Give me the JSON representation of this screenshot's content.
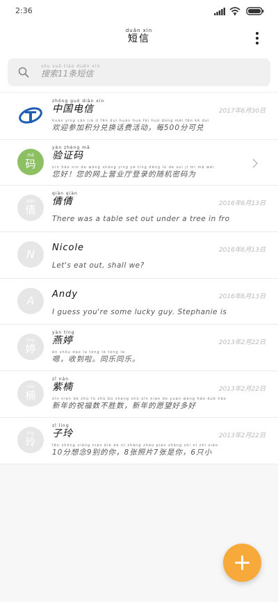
{
  "status_bar": {
    "time": "2:36"
  },
  "header": {
    "title_pinyin": "duǎn xìn",
    "title": "短信"
  },
  "search": {
    "placeholder_pinyin": "sōu suǒ  tiáo duǎn xìn",
    "placeholder": "搜索11条短信"
  },
  "conversations": [
    {
      "avatar_type": "telecom-logo",
      "name_pinyin": "zhōng guó diàn xìn",
      "name": "中国电信",
      "date": "2017年6月30日",
      "preview_pinyin": "huān yíng cān jiā jī fēn duì huàn huà fèi huó dòng  měi  fēn kě duì",
      "preview": "欢迎参加积分兑换话费活动，每500分可兑"
    },
    {
      "avatar_type": "green",
      "avatar_pinyin": "mǎ",
      "avatar_char": "码",
      "name_pinyin": "yàn zhèng mǎ",
      "name": "验证码",
      "date": "",
      "preview_pinyin": "nín hǎo  nín de wǎng shàng yíng yè tīng dēng lù de suí jī mì mǎ wéi",
      "preview": "您好！您的网上营业厅登录的随机密码为",
      "has_chevron": true
    },
    {
      "avatar_type": "gray",
      "avatar_pinyin": "qiàn",
      "avatar_char": "倩",
      "name_pinyin": "qiàn qiàn",
      "name": "倩倩",
      "date": "2016年6月13日",
      "preview": "There was a table set out under a tree in front o"
    },
    {
      "avatar_type": "gray-letter",
      "avatar_letter": "N",
      "name": "Nicole",
      "date": "2016年6月13日",
      "preview": "Let's eat out, shall we?"
    },
    {
      "avatar_type": "gray-letter",
      "avatar_letter": "A",
      "name": "Andy",
      "date": "2016年6月13日",
      "preview": "I guess you're some lucky guy. Stephanie is a nice"
    },
    {
      "avatar_type": "gray",
      "avatar_pinyin": "tíng",
      "avatar_char": "婷",
      "name_pinyin": "yàn tíng",
      "name": "燕婷",
      "date": "2013年2月22日",
      "preview_pinyin": "ēn  shōu dào le  tóng lè tóng lè",
      "preview": "嗯，收到啦。同乐同乐。"
    },
    {
      "avatar_type": "gray",
      "avatar_pinyin": "nán",
      "avatar_char": "楠",
      "name_pinyin": "zǐ nán",
      "name": "紫楠",
      "date": "2013年2月22日",
      "preview_pinyin": "xīn nián de zhù fú shù bú shèng shǔ  xīn nián de yuàn wàng hǎo duō hǎo",
      "preview": "新年的祝福数不胜数，新年的愿望好多好"
    },
    {
      "avatar_type": "gray",
      "avatar_pinyin": "líng",
      "avatar_char": "玲",
      "name_pinyin": "zǐ líng",
      "name": "子玲",
      "date": "2013年2月22日",
      "preview_pinyin": "fēn zhōng xiǎng niàn bié de nǐ   zhāng zhào piàn  zhāng shì nǐ   zhī xiǎo",
      "preview": "10分想念9别的你，8张照片7张是你，6只小"
    }
  ],
  "colors": {
    "fab": "#f7a93a",
    "verify_avatar": "#8cc063",
    "avatar_gray": "#e6e6e6"
  },
  "fab": {
    "icon": "plus-icon"
  }
}
